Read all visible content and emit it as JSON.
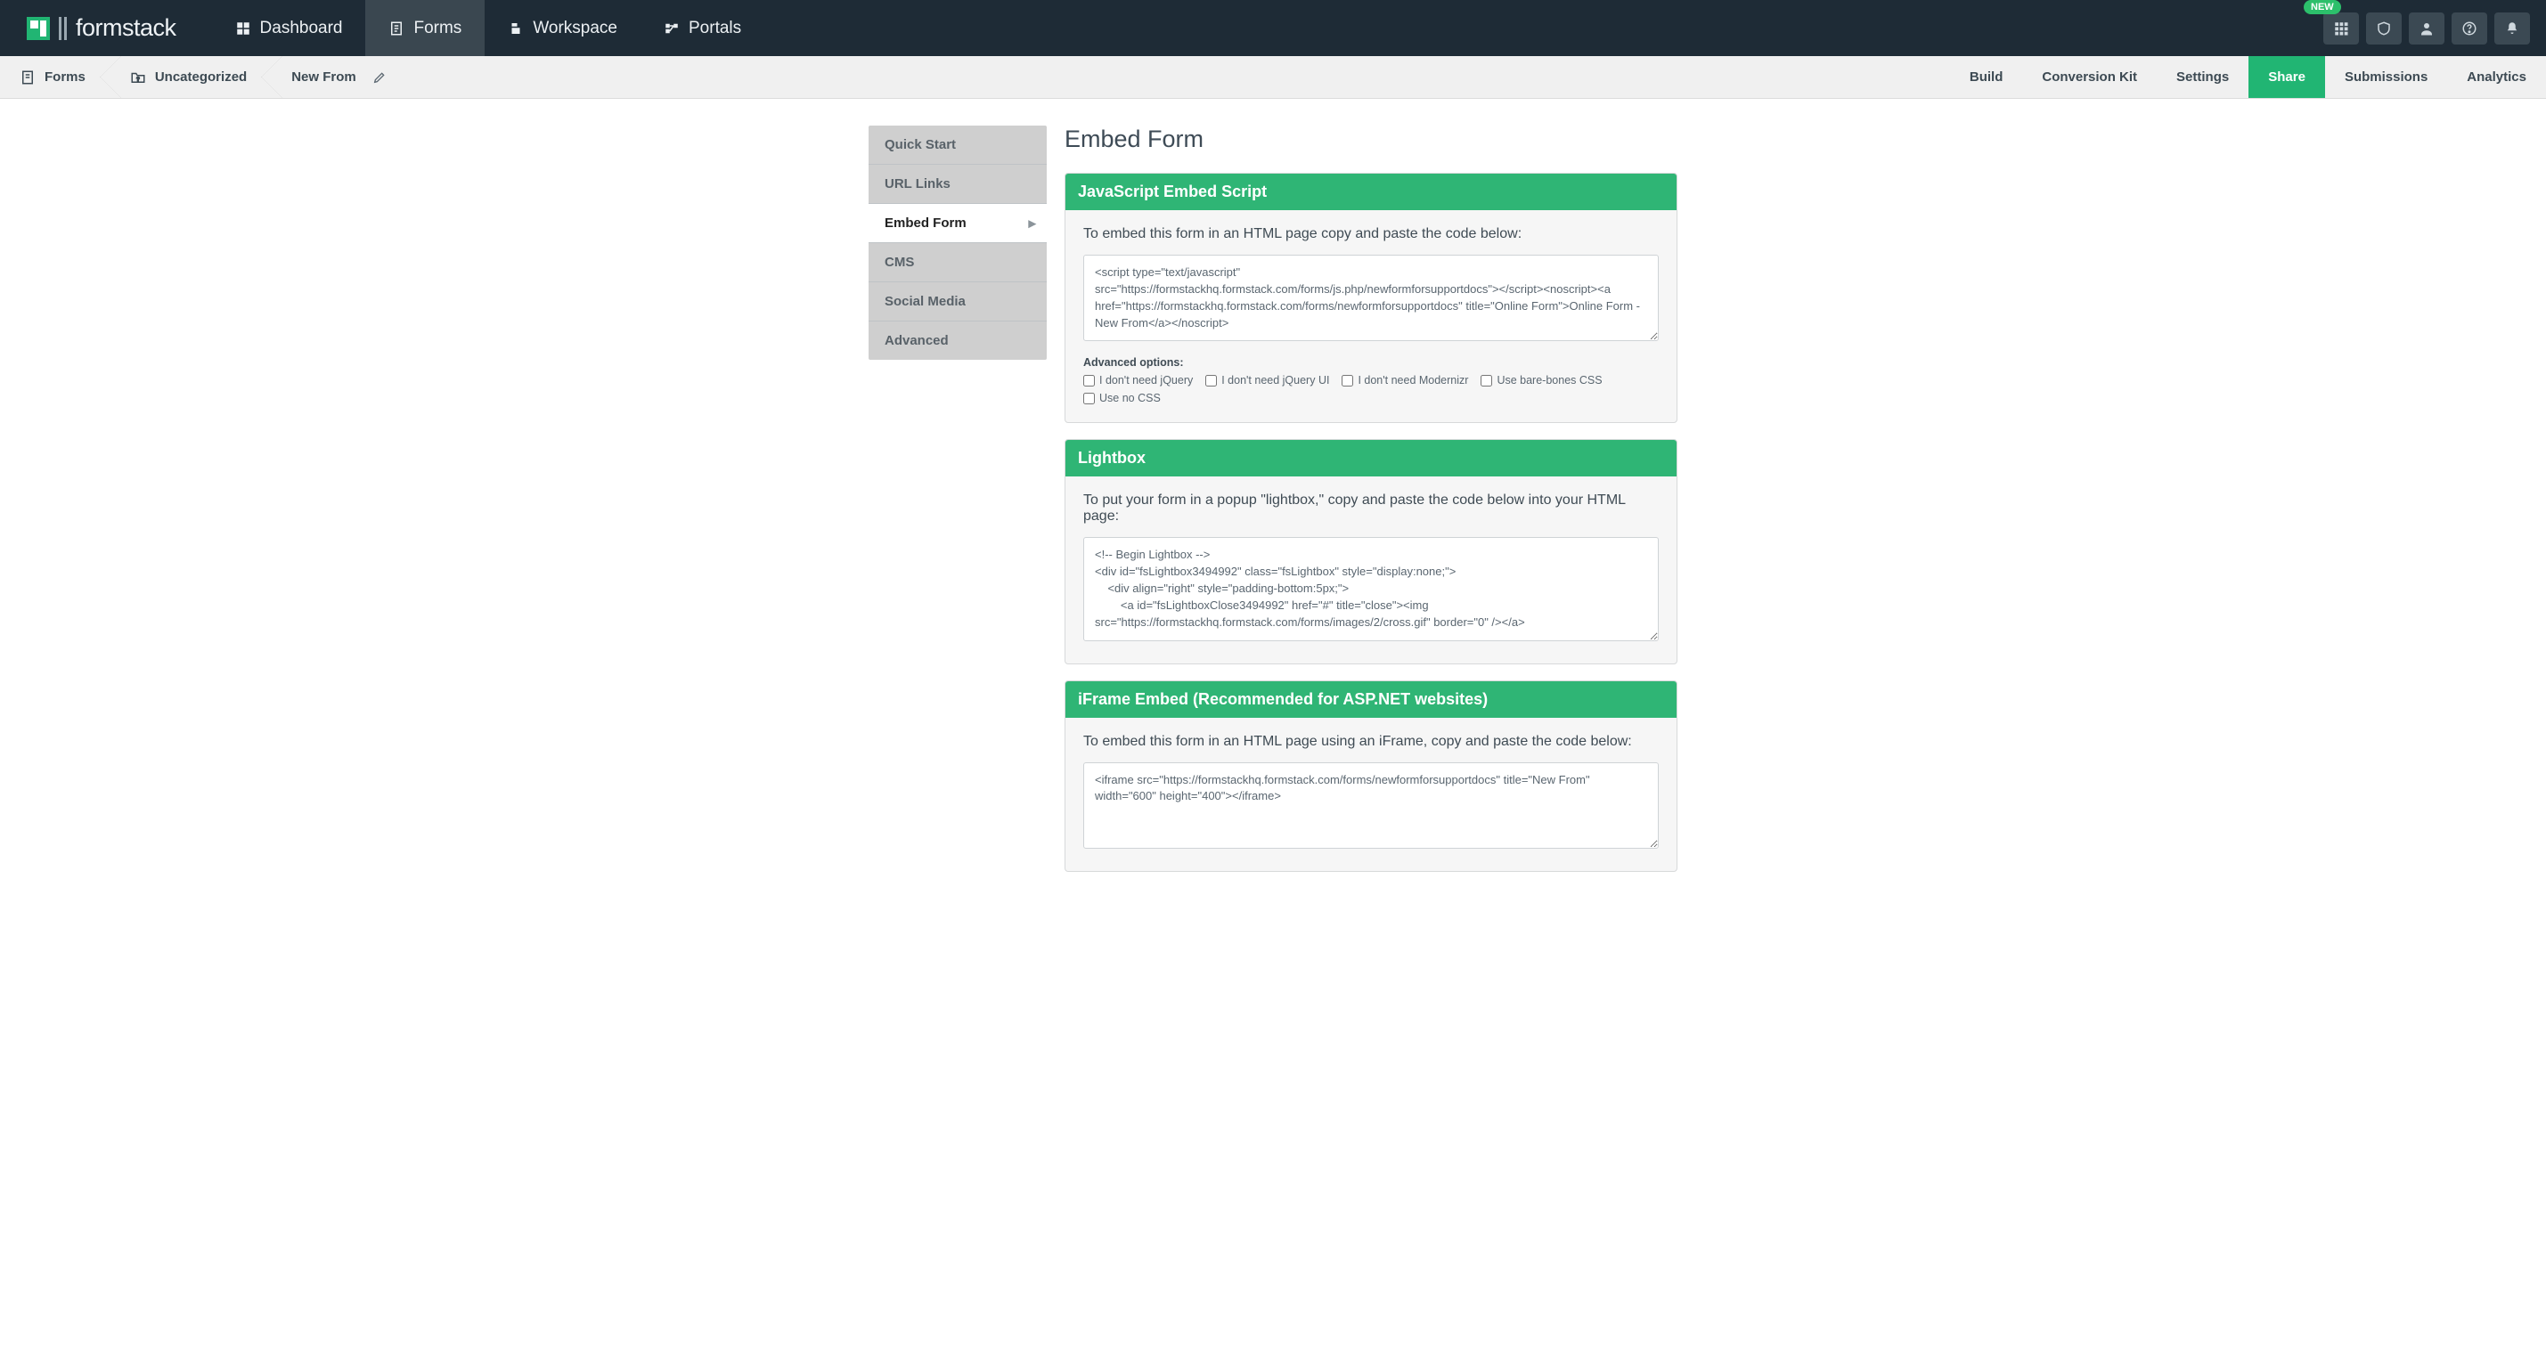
{
  "brand": {
    "name": "formstack"
  },
  "top_nav": {
    "items": [
      {
        "label": "Dashboard"
      },
      {
        "label": "Forms"
      },
      {
        "label": "Workspace"
      },
      {
        "label": "Portals"
      }
    ],
    "new_badge": "NEW"
  },
  "breadcrumb": {
    "items": [
      {
        "label": "Forms"
      },
      {
        "label": "Uncategorized"
      },
      {
        "label": "New From"
      }
    ]
  },
  "form_tabs": {
    "items": [
      {
        "label": "Build"
      },
      {
        "label": "Conversion Kit"
      },
      {
        "label": "Settings"
      },
      {
        "label": "Share"
      },
      {
        "label": "Submissions"
      },
      {
        "label": "Analytics"
      }
    ]
  },
  "side_nav": {
    "items": [
      {
        "label": "Quick Start"
      },
      {
        "label": "URL Links"
      },
      {
        "label": "Embed Form"
      },
      {
        "label": "CMS"
      },
      {
        "label": "Social Media"
      },
      {
        "label": "Advanced"
      }
    ]
  },
  "page": {
    "title": "Embed Form"
  },
  "panels": {
    "js": {
      "title": "JavaScript Embed Script",
      "lead": "To embed this form in an HTML page copy and paste the code below:",
      "code": "<script type=\"text/javascript\" src=\"https://formstackhq.formstack.com/forms/js.php/newformforsupportdocs\"></script><noscript><a href=\"https://formstackhq.formstack.com/forms/newformforsupportdocs\" title=\"Online Form\">Online Form - New From</a></noscript>",
      "adv_label": "Advanced options:",
      "opts": [
        "I don't need jQuery",
        "I don't need jQuery UI",
        "I don't need Modernizr",
        "Use bare-bones CSS",
        "Use no CSS"
      ]
    },
    "lightbox": {
      "title": "Lightbox",
      "lead": "To put your form in a popup \"lightbox,\" copy and paste the code below into your HTML page:",
      "code": "<!-- Begin Lightbox -->\n<div id=\"fsLightbox3494992\" class=\"fsLightbox\" style=\"display:none;\">\n    <div align=\"right\" style=\"padding-bottom:5px;\">\n        <a id=\"fsLightboxClose3494992\" href=\"#\" title=\"close\"><img src=\"https://formstackhq.formstack.com/forms/images/2/cross.gif\" border=\"0\" /></a>"
    },
    "iframe": {
      "title": "iFrame Embed (Recommended for ASP.NET websites)",
      "lead": "To embed this form in an HTML page using an iFrame, copy and paste the code below:",
      "code": "<iframe src=\"https://formstackhq.formstack.com/forms/newformforsupportdocs\" title=\"New From\" width=\"600\" height=\"400\"></iframe>"
    }
  }
}
